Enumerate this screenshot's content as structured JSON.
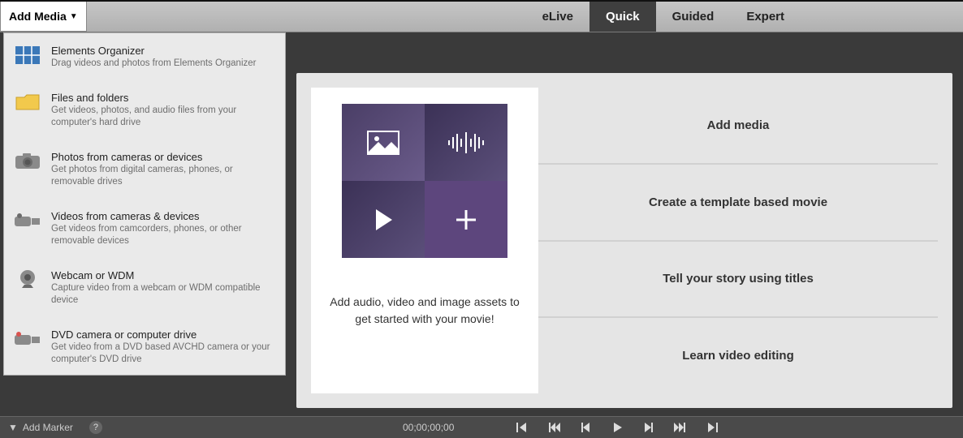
{
  "topbar": {
    "add_media": "Add Media",
    "tabs": {
      "elive": "eLive",
      "quick": "Quick",
      "guided": "Guided",
      "expert": "Expert"
    }
  },
  "dropdown": {
    "items": [
      {
        "title": "Elements Organizer",
        "desc": "Drag videos and photos from Elements Organizer"
      },
      {
        "title": "Files and folders",
        "desc": "Get videos, photos, and audio files from your computer's hard drive"
      },
      {
        "title": "Photos from cameras or devices",
        "desc": "Get photos from digital cameras, phones, or removable drives"
      },
      {
        "title": "Videos from cameras & devices",
        "desc": "Get videos from camcorders, phones, or other removable devices"
      },
      {
        "title": "Webcam or WDM",
        "desc": "Capture video from a webcam or WDM compatible device"
      },
      {
        "title": "DVD camera or computer drive",
        "desc": "Get video from a DVD based AVCHD camera or your computer's DVD drive"
      }
    ]
  },
  "main": {
    "hero_caption": "Add audio, video and image assets to get started with your movie!",
    "cards": [
      "Add media",
      "Create a template based movie",
      "Tell your story using titles",
      "Learn video editing"
    ]
  },
  "bottombar": {
    "marker_label": "Add Marker",
    "timecode": "00;00;00;00"
  }
}
